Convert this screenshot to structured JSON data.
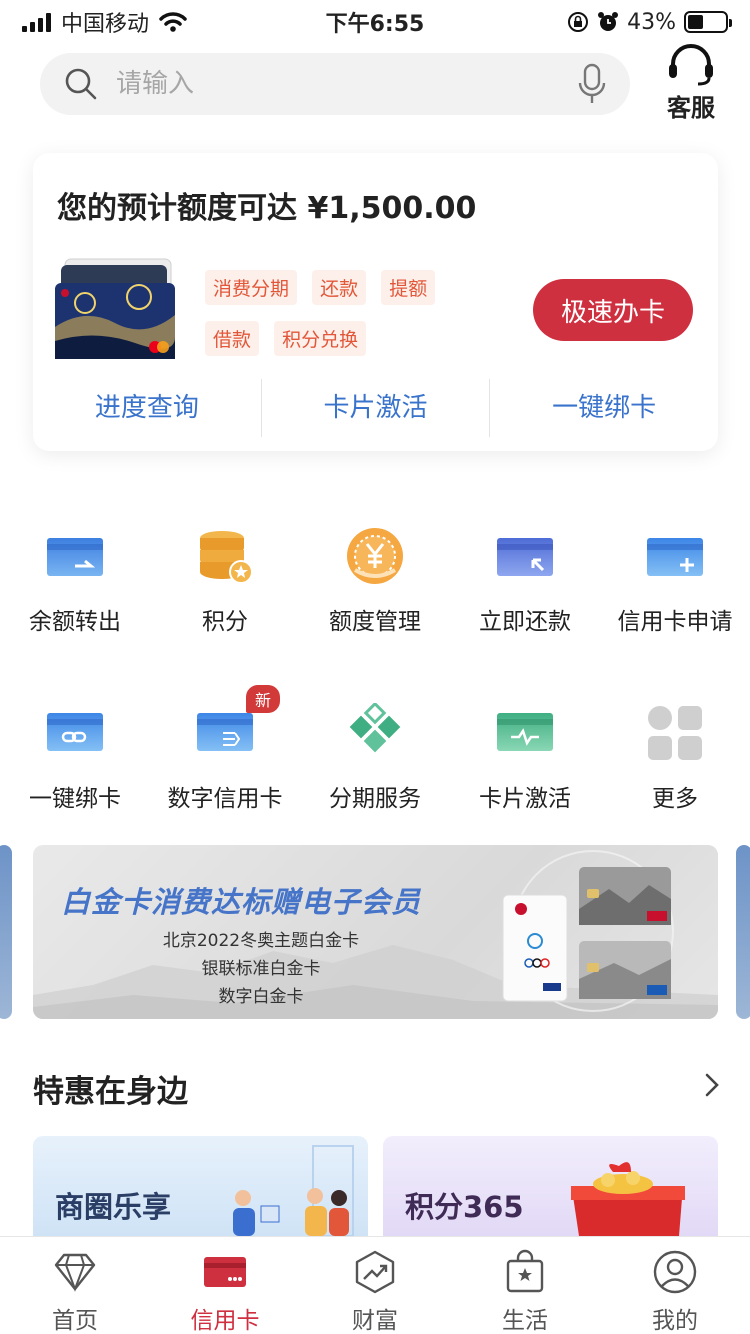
{
  "status": {
    "carrier": "中国移动",
    "time": "下午6:55",
    "battery": "43%",
    "battery_level": 0.43
  },
  "search": {
    "placeholder": "请输入"
  },
  "service": {
    "label": "客服"
  },
  "card_panel": {
    "limit_text": "您的预计额度可达 ¥1,500.00",
    "tags": [
      "消费分期",
      "还款",
      "提额",
      "借款",
      "积分兑换"
    ],
    "apply_label": "极速办卡",
    "quick_links": [
      "进度查询",
      "卡片激活",
      "一键绑卡"
    ]
  },
  "grid_row1": [
    "余额转出",
    "积分",
    "额度管理",
    "立即还款",
    "信用卡申请"
  ],
  "grid_row2": [
    "一键绑卡",
    "数字信用卡",
    "分期服务",
    "卡片激活",
    "更多"
  ],
  "new_badge": "新",
  "banner": {
    "title": "白金卡消费达标赠电子会员",
    "lines": [
      "北京2022冬奥主题白金卡",
      "银联标准白金卡",
      "数字白金卡"
    ]
  },
  "deals": {
    "title": "特惠在身边",
    "cards": [
      "商圈乐享",
      "积分365"
    ]
  },
  "tabs": [
    "首页",
    "信用卡",
    "财富",
    "生活",
    "我的"
  ],
  "colors": {
    "brand_red": "#cf3040",
    "link_blue": "#3a73cc",
    "tag_text": "#e2573a"
  }
}
